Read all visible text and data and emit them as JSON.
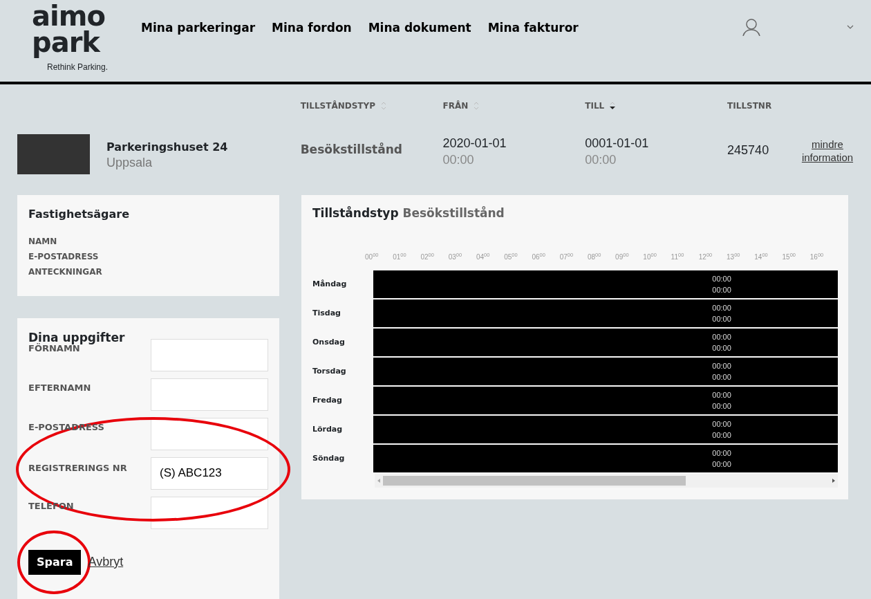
{
  "header": {
    "logo": {
      "wordmark_top": "aimo",
      "wordmark_bottom": "park",
      "tagline": "Rethink Parking."
    },
    "nav": [
      "Mina parkeringar",
      "Mina fordon",
      "Mina dokument",
      "Mina fakturor"
    ]
  },
  "permit": {
    "columns": [
      {
        "label": "TILLSTÅNDSTYP",
        "sorted": false
      },
      {
        "label": "FRÅN",
        "sorted": false
      },
      {
        "label": "TILL",
        "sorted": true
      },
      {
        "label": "TILLSTNR"
      }
    ],
    "name": "Parkeringshuset 24",
    "city": "Uppsala",
    "type": "Besökstillstånd",
    "from_date": "2020-01-01",
    "from_time": "00:00",
    "to_date": "0001-01-01",
    "to_time": "00:00",
    "number": "245740",
    "link": "mindre information"
  },
  "owner_card": {
    "title": "Fastighetsägare",
    "fields": [
      "NAMN",
      "E-POSTADRESS",
      "ANTECKNINGAR"
    ]
  },
  "details_form": {
    "title": "Dina uppgifter",
    "fields": [
      {
        "label": "FÖRNAMN",
        "highlighted": false
      },
      {
        "label": "EFTERNAMN",
        "highlighted": false
      },
      {
        "label": "E-POSTADRESS",
        "highlighted": false
      },
      {
        "label": "REGISTRERINGS NR",
        "value": "(S) ABC123",
        "highlighted": true
      },
      {
        "label": "TELEFON",
        "highlighted": false
      }
    ],
    "save": {
      "label": "Spara",
      "highlighted": true
    },
    "cancel": "Avbryt"
  },
  "schedule": {
    "title": "Tillståndstyp",
    "title_value": "Besökstillstånd",
    "hours": [
      "00$^{00}$",
      "01$^{00}$",
      "02$^{00}$",
      "03$^{00}$",
      "04$^{00}$",
      "05$^{00}$",
      "06$^{00}$",
      "07$^{00}$",
      "08$^{00}$",
      "09$^{00}$",
      "10$^{00}$",
      "11$^{00}$",
      "12$^{00}$",
      "13$^{00}$",
      "14$^{00}$",
      "15$^{00}$",
      "16$^{00}$"
    ],
    "days": [
      {
        "name": "Måndag",
        "start": "00:00",
        "end": "00:00"
      },
      {
        "name": "Tisdag",
        "start": "00:00",
        "end": "00:00"
      },
      {
        "name": "Onsdag",
        "start": "00:00",
        "end": "00:00"
      },
      {
        "name": "Torsdag",
        "start": "00:00",
        "end": "00:00"
      },
      {
        "name": "Fredag",
        "start": "00:00",
        "end": "00:00"
      },
      {
        "name": "Lördag",
        "start": "00:00",
        "end": "00:00"
      },
      {
        "name": "Söndag",
        "start": "00:00",
        "end": "00:00"
      }
    ]
  }
}
